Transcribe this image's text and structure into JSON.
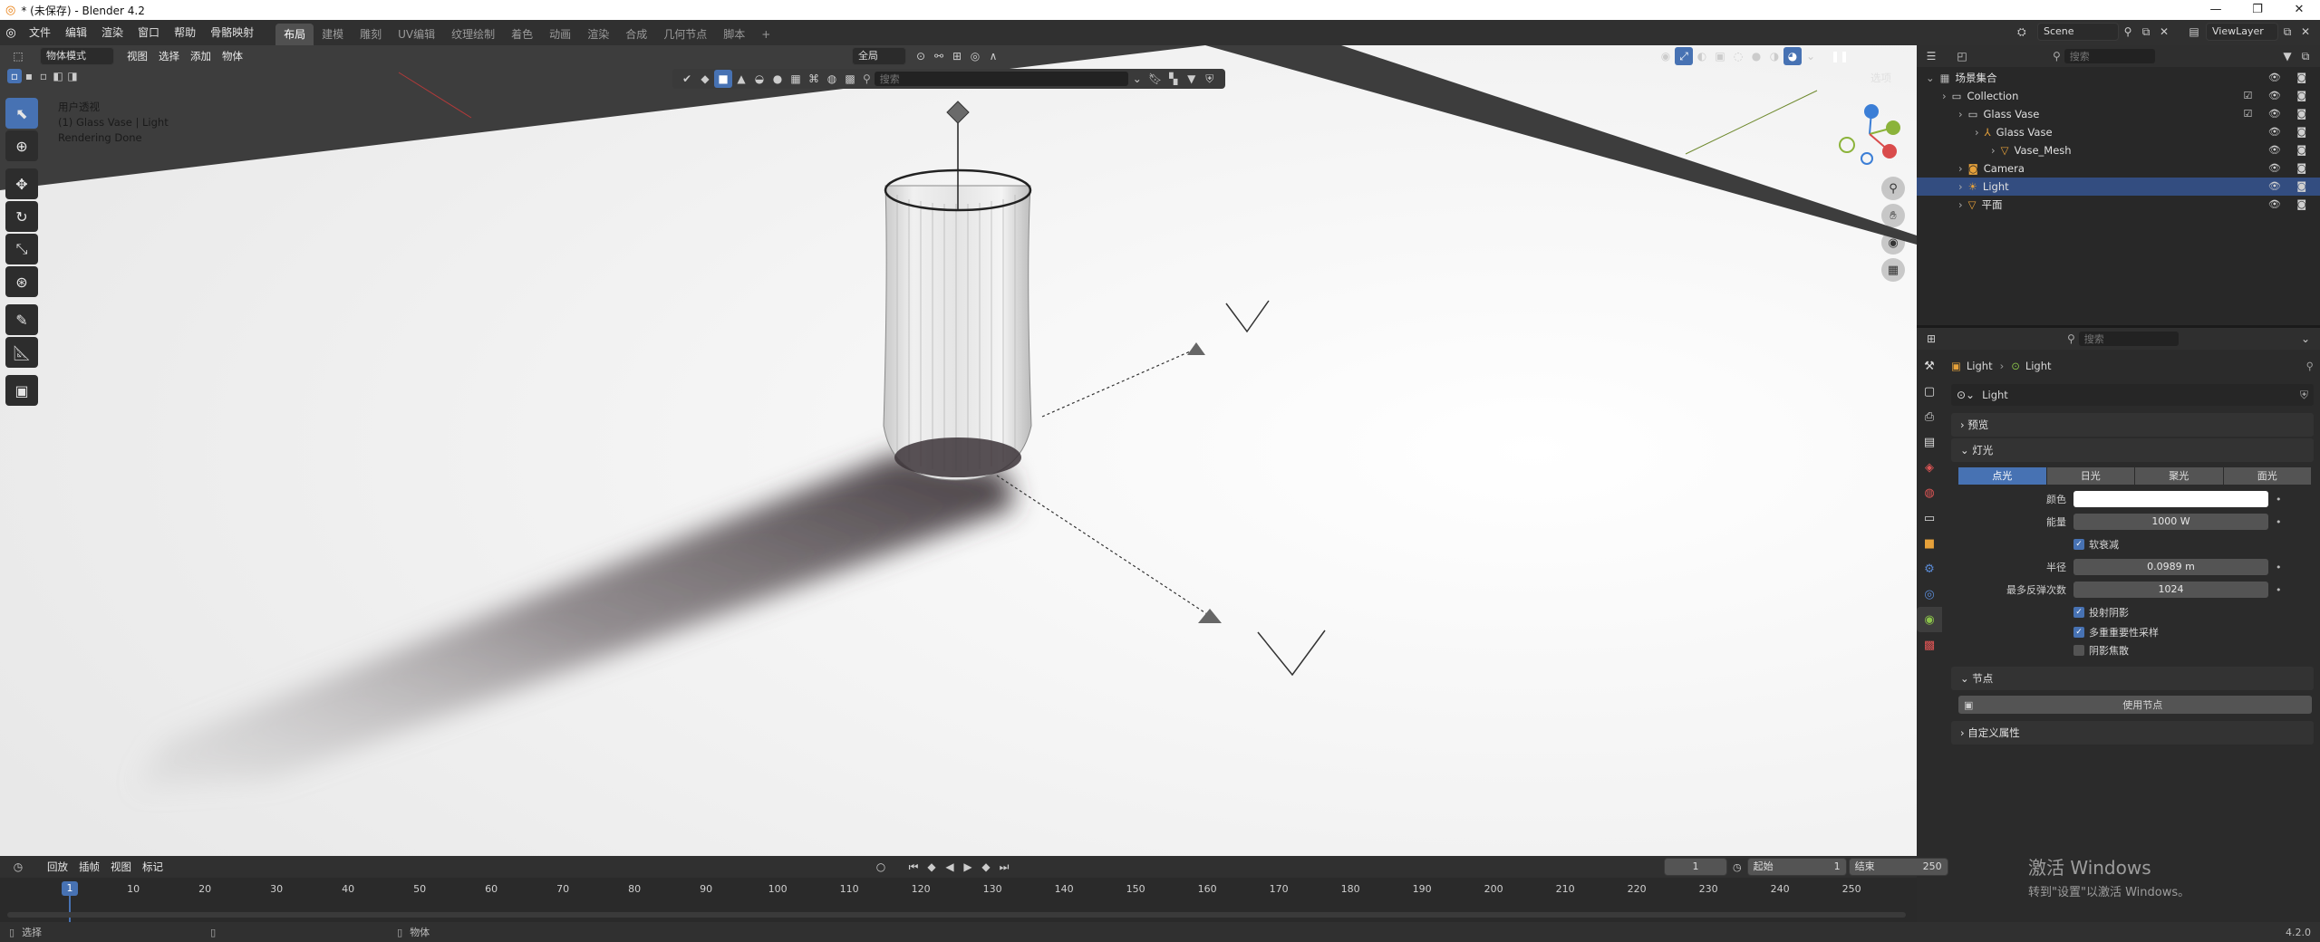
{
  "window": {
    "title": "* (未保存) - Blender 4.2"
  },
  "menu": [
    "文件",
    "编辑",
    "渲染",
    "窗口",
    "帮助",
    "骨骼映射"
  ],
  "workspaces": [
    {
      "label": "布局",
      "active": true
    },
    {
      "label": "建模"
    },
    {
      "label": "雕刻"
    },
    {
      "label": "UV编辑"
    },
    {
      "label": "纹理绘制"
    },
    {
      "label": "着色"
    },
    {
      "label": "动画"
    },
    {
      "label": "渲染"
    },
    {
      "label": "合成"
    },
    {
      "label": "几何节点"
    },
    {
      "label": "脚本"
    },
    {
      "label": "+"
    }
  ],
  "scene": {
    "name": "Scene",
    "view_layer": "ViewLayer"
  },
  "viewport": {
    "mode": "物体模式",
    "menus": [
      "视图",
      "选择",
      "添加",
      "物体"
    ],
    "transform_orientation": "全局",
    "search_placeholder": "搜索",
    "options_label": "选项",
    "overlay": [
      "用户透视",
      "(1) Glass Vase | Light",
      "Rendering Done"
    ]
  },
  "outliner": {
    "search_placeholder": "搜索",
    "rows": [
      {
        "label": "场景集合",
        "indent": 0,
        "icon": "scene-collection-icon",
        "color": "#bbbbbb"
      },
      {
        "label": "Collection",
        "indent": 1,
        "icon": "collection-icon",
        "color": "#dddddd",
        "check": true
      },
      {
        "label": "Glass Vase",
        "indent": 2,
        "icon": "collection-icon",
        "color": "#dddddd",
        "check": true
      },
      {
        "label": "Glass Vase",
        "indent": 3,
        "icon": "armature-icon",
        "color": "#e6a13a"
      },
      {
        "label": "Vase_Mesh",
        "indent": 4,
        "icon": "mesh-icon",
        "color": "#e6a13a"
      },
      {
        "label": "Camera",
        "indent": 2,
        "icon": "camera-icon",
        "color": "#e6a13a"
      },
      {
        "label": "Light",
        "indent": 2,
        "icon": "light-icon",
        "color": "#e6a13a",
        "selected": true
      },
      {
        "label": "平面",
        "indent": 2,
        "icon": "mesh-icon",
        "color": "#e6a13a"
      }
    ]
  },
  "properties": {
    "search_placeholder": "搜索",
    "breadcrumb": [
      "Light",
      "Light"
    ],
    "datablock": "Light",
    "panels": {
      "preview": "预览",
      "light": "灯光",
      "nodes": "节点",
      "custom": "自定义属性"
    },
    "light_types": [
      {
        "label": "点光",
        "active": true
      },
      {
        "label": "日光"
      },
      {
        "label": "聚光"
      },
      {
        "label": "面光"
      }
    ],
    "color_label": "颜色",
    "color_value": "#ffffff",
    "power_label": "能量",
    "power_value": "1000 W",
    "soft_falloff": "软衰减",
    "radius_label": "半径",
    "radius_value": "0.0989 m",
    "max_bounces_label": "最多反弹次数",
    "max_bounces_value": "1024",
    "cast_shadow": "投射阴影",
    "multiple_importance": "多重重要性采样",
    "shadow_caustics": "阴影焦散",
    "use_nodes": "使用节点"
  },
  "timeline": {
    "menus": [
      "回放",
      "插帧",
      "视图",
      "标记"
    ],
    "current_frame": "1",
    "start_label": "起始",
    "start_value": "1",
    "end_label": "结束",
    "end_value": "250",
    "ticks": [
      "1",
      "10",
      "20",
      "30",
      "40",
      "50",
      "60",
      "70",
      "80",
      "90",
      "100",
      "110",
      "120",
      "130",
      "140",
      "150",
      "160",
      "170",
      "180",
      "190",
      "200",
      "210",
      "220",
      "230",
      "240",
      "250"
    ]
  },
  "statusbar": {
    "select": "选择",
    "object": "物体",
    "version": "4.2.0"
  },
  "watermark": {
    "line1": "激活 Windows",
    "line2": "转到\"设置\"以激活 Windows。"
  }
}
